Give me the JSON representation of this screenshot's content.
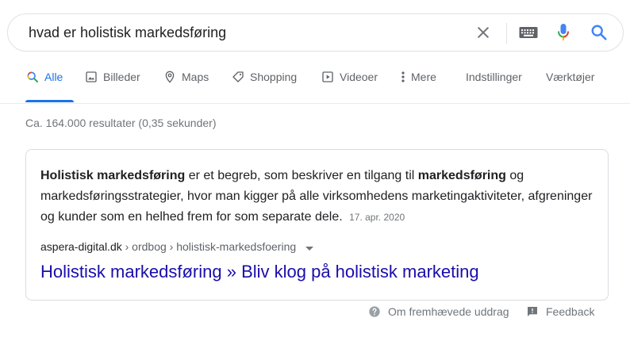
{
  "search": {
    "query": "hvad er holistisk markedsføring"
  },
  "tabs": [
    {
      "label": "Alle",
      "icon": "search-icon",
      "active": true
    },
    {
      "label": "Billeder",
      "icon": "image-icon"
    },
    {
      "label": "Maps",
      "icon": "map-pin-icon"
    },
    {
      "label": "Shopping",
      "icon": "tag-icon"
    },
    {
      "label": "Videoer",
      "icon": "play-icon"
    },
    {
      "label": "Mere",
      "icon": "more-vert-icon"
    }
  ],
  "tools": {
    "settings_label": "Indstillinger",
    "tools_label": "Værktøjer"
  },
  "result_stats": "Ca. 164.000 resultater (0,35 sekunder)",
  "featured_snippet": {
    "parts": [
      {
        "text": "Holistisk markedsføring",
        "bold": true
      },
      {
        "text": " er et begreb, som beskriver en tilgang til ",
        "bold": false
      },
      {
        "text": "markedsføring",
        "bold": true
      },
      {
        "text": " og markedsføringsstrategier, hvor man kigger på alle virksomhedens marketingaktiviteter, afgreninger og kunder som en helhed frem for som separate dele.",
        "bold": false
      }
    ],
    "date": "17. apr. 2020",
    "cite_domain": "aspera-digital.dk",
    "cite_path": " › ordbog › holistisk-markedsfoering",
    "title": "Holistisk markedsføring » Bliv klog på holistisk marketing"
  },
  "footer": {
    "about_label": "Om fremhævede uddrag",
    "feedback_label": "Feedback"
  },
  "colors": {
    "accent": "#1a73e8",
    "link": "#1a0dab",
    "muted": "#70757a",
    "mic_blue": "#4285f4",
    "mic_red": "#ea4335"
  }
}
